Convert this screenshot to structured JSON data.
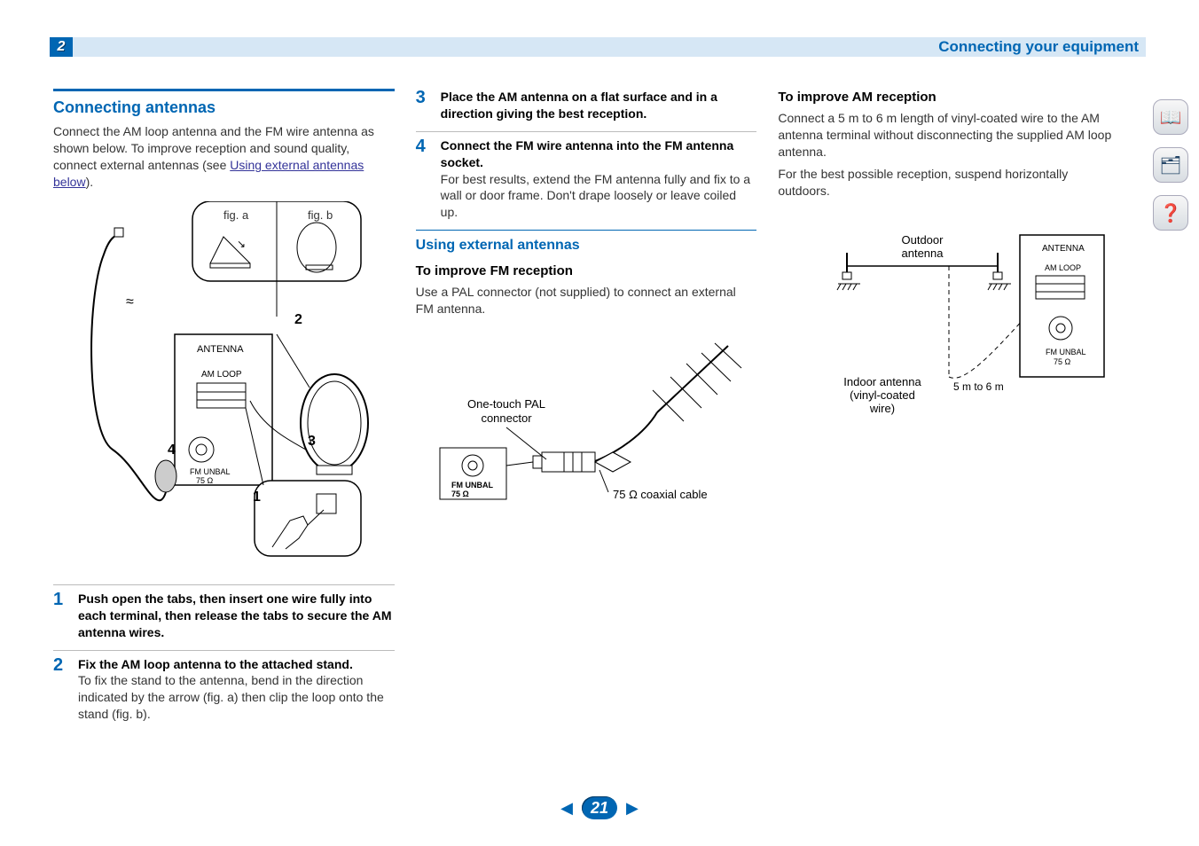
{
  "header": {
    "chapter_number": "2",
    "title": "Connecting your equipment"
  },
  "page_number": "21",
  "side_nav": {
    "book": "📖",
    "device": "🗂",
    "help": "❓"
  },
  "col1": {
    "h2": "Connecting antennas",
    "intro_before_link": "Connect the AM loop antenna and the FM wire antenna as shown below. To improve reception and sound quality, connect external antennas (see ",
    "link_text": "Using external antennas below",
    "intro_after_link": ").",
    "fig_a": "fig. a",
    "fig_b": "fig. b",
    "panel": {
      "antenna": "ANTENNA",
      "amloop": "AM LOOP",
      "fmunbal": "FM UNBAL",
      "fmohm": "75 Ω"
    },
    "steps": [
      {
        "n": "1",
        "title": "Push open the tabs, then insert one wire fully into each terminal, then release the tabs to secure the AM antenna wires.",
        "desc": ""
      },
      {
        "n": "2",
        "title": "Fix the AM loop antenna to the attached stand.",
        "desc": "To fix the stand to the antenna, bend in the direction indicated by the arrow (fig. a) then clip the loop onto the stand (fig. b)."
      }
    ]
  },
  "col2": {
    "steps": [
      {
        "n": "3",
        "title": "Place the AM antenna on a flat surface and in a direction giving the best reception.",
        "desc": ""
      },
      {
        "n": "4",
        "title": "Connect the FM wire antenna into the FM antenna socket.",
        "desc": "For best results, extend the FM antenna fully and fix to a wall or door frame. Don't drape loosely or leave coiled up."
      }
    ],
    "h3": "Using external antennas",
    "h4": "To improve FM reception",
    "p": "Use a PAL connector (not supplied) to connect an external FM antenna.",
    "diagram": {
      "pal_label_line1": "One-touch PAL",
      "pal_label_line2": "connector",
      "fmunbal": "FM UNBAL",
      "fmohm": "75 Ω",
      "coax": "75 Ω coaxial cable"
    }
  },
  "col3": {
    "h4": "To improve AM reception",
    "p1": "Connect a 5 m to 6 m length of vinyl-coated wire to the AM antenna terminal without disconnecting the supplied AM loop antenna.",
    "p2": "For the best possible reception, suspend horizontally outdoors.",
    "diagram": {
      "outdoor_line1": "Outdoor",
      "outdoor_line2": "antenna",
      "indoor_line1": "Indoor antenna",
      "indoor_line2": "(vinyl-coated",
      "indoor_line3": "wire)",
      "length": "5 m to 6 m",
      "antenna": "ANTENNA",
      "amloop": "AM LOOP",
      "fmunbal": "FM UNBAL",
      "fmohm": "75 Ω"
    }
  }
}
